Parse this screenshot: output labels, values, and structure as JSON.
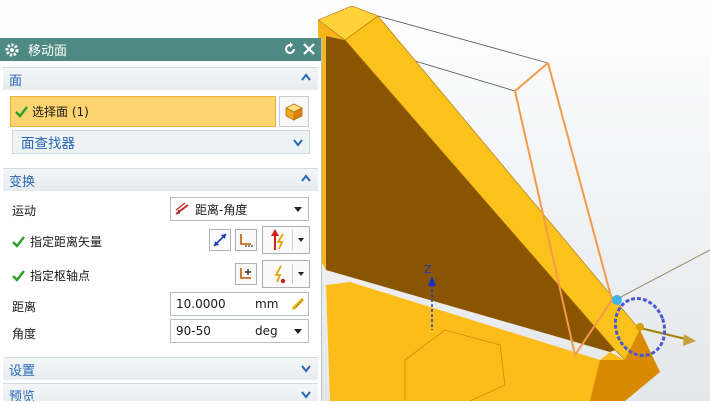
{
  "dialog": {
    "title": "移动面",
    "sections": {
      "face": {
        "label": "面",
        "selection_label": "选择面 (1)",
        "finder_label": "面查找器"
      },
      "transform": {
        "label": "变换",
        "motion_label": "运动",
        "motion_value": "距离-角度",
        "distance_vector_label": "指定距离矢量",
        "pivot_label": "指定枢轴点",
        "distance_label": "距离",
        "distance_value": "10.0000",
        "distance_unit": "mm",
        "angle_label": "角度",
        "angle_value": "90-50",
        "angle_unit": "deg"
      },
      "settings": {
        "label": "设置"
      },
      "preview": {
        "label": "预览"
      }
    }
  },
  "viewport": {
    "axis_label": "Z",
    "model_color": "#fcbd1a",
    "model_dark_color": "#8a5500",
    "preview_outline_color": "#f39a4d"
  }
}
